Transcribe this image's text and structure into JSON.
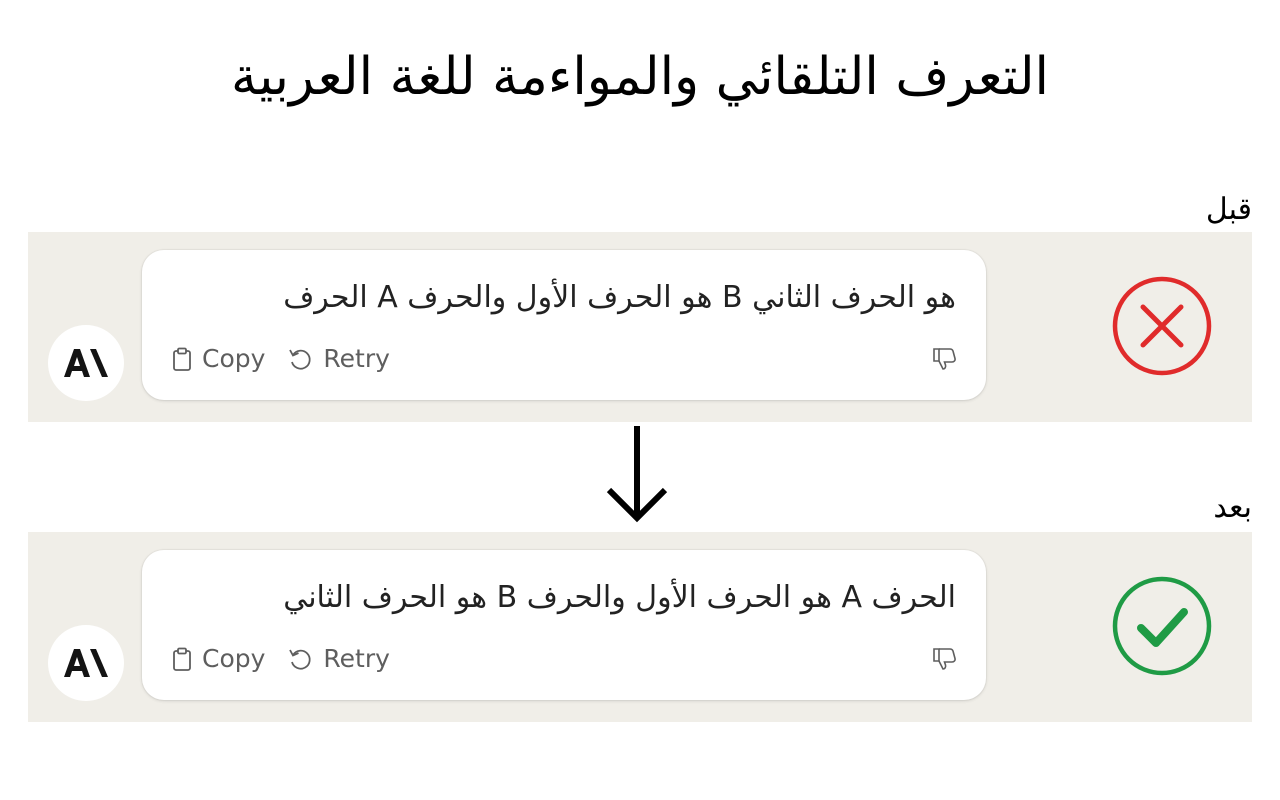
{
  "title": "التعرف التلقائي والمواءمة للغة العربية",
  "before": {
    "label": "قبل",
    "message": "هو الحرف الثاني B هو الحرف الأول والحرف A الحرف",
    "copy_label": "Copy",
    "retry_label": "Retry",
    "status_icon": "x-circle-icon",
    "status_color": "#e02b2b"
  },
  "after": {
    "label": "بعد",
    "message": "الحرف A هو الحرف الأول والحرف B هو الحرف الثاني",
    "copy_label": "Copy",
    "retry_label": "Retry",
    "status_icon": "check-circle-icon",
    "status_color": "#1f9b45"
  },
  "colors": {
    "band": "#f0eee8",
    "card": "#ffffff",
    "text": "#222222",
    "muted": "#5e5e5e"
  },
  "avatar_logo": "AI"
}
